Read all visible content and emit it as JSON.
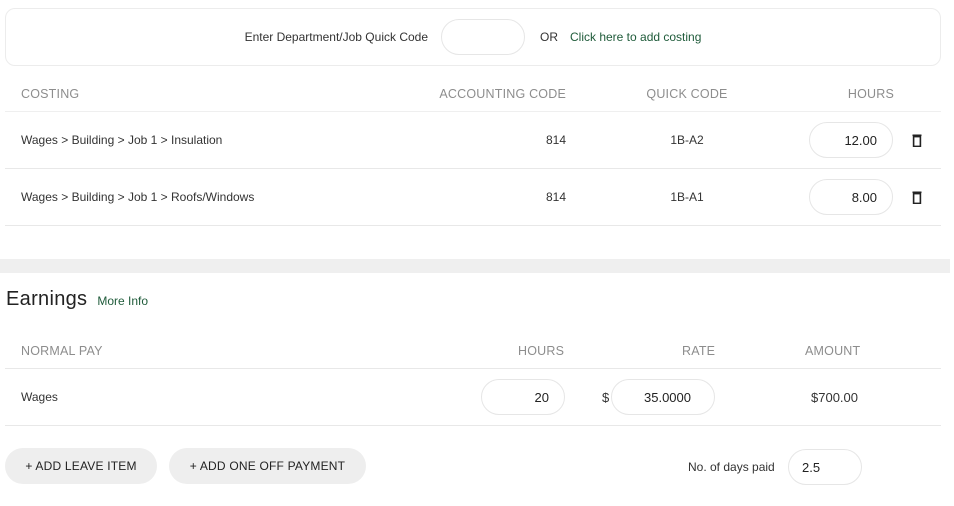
{
  "quick_code_bar": {
    "label": "Enter Department/Job Quick Code",
    "input_value": "",
    "or_text": "OR",
    "add_costing_link": "Click here to add costing"
  },
  "costing_table": {
    "headers": {
      "costing": "COSTING",
      "accounting_code": "ACCOUNTING CODE",
      "quick_code": "QUICK CODE",
      "hours": "HOURS"
    },
    "rows": [
      {
        "costing": "Wages > Building > Job 1 > Insulation",
        "accounting_code": "814",
        "quick_code": "1B-A2",
        "hours": "12.00",
        "delete_icon": "trash-icon"
      },
      {
        "costing": "Wages > Building > Job 1 > Roofs/Windows",
        "accounting_code": "814",
        "quick_code": "1B-A1",
        "hours": "8.00",
        "delete_icon": "trash-icon"
      }
    ]
  },
  "earnings": {
    "title": "Earnings",
    "more_info_link": "More Info",
    "headers": {
      "normal_pay": "NORMAL PAY",
      "hours": "HOURS",
      "rate": "RATE",
      "amount": "AMOUNT"
    },
    "rows": [
      {
        "name": "Wages",
        "hours": "20",
        "currency": "$",
        "rate": "35.0000",
        "amount": "$700.00"
      }
    ]
  },
  "actions": {
    "add_leave_item": "+ ADD LEAVE ITEM",
    "add_one_off_payment": "+ ADD ONE OFF PAYMENT"
  },
  "days_paid": {
    "label": "No. of days paid",
    "value": "2.5"
  },
  "colors": {
    "link": "#1f5b3a",
    "header_text": "#8d8d8d",
    "button_bg": "#eeeeee",
    "separator": "#efefef"
  }
}
